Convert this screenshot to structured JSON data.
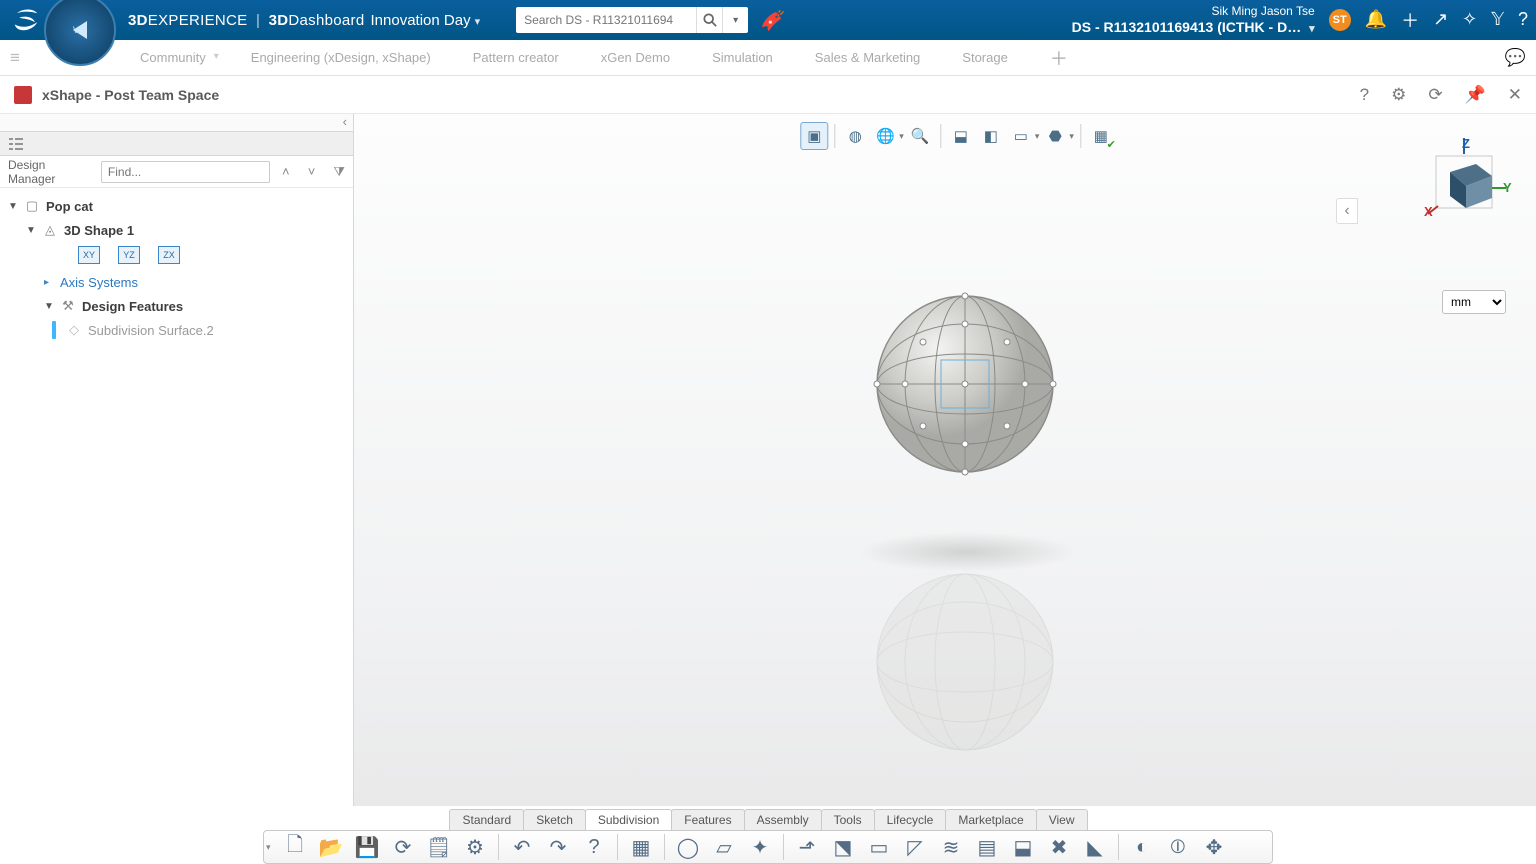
{
  "topbar": {
    "brand_pre": "3D",
    "brand_main": "EXPERIENCE",
    "brand_sep": "|",
    "brand_sub_bold": "3D",
    "brand_sub": "Dashboard",
    "context_dd": "Innovation Day",
    "search_placeholder": "Search DS - R11321011694",
    "user_name": "Sik Ming Jason Tse",
    "context_label": "DS - R1132101169413 (ICTHK - D…",
    "avatar_initials": "ST"
  },
  "tabstrip": {
    "items": [
      "Community",
      "Engineering (xDesign, xShape)",
      "Pattern creator",
      "xGen Demo",
      "Simulation",
      "Sales & Marketing",
      "Storage"
    ]
  },
  "apphdr": {
    "title": "xShape - Post Team Space"
  },
  "dm": {
    "label": "Design Manager",
    "find_placeholder": "Find..."
  },
  "tree": {
    "root": "Pop cat",
    "shape": "3D Shape 1",
    "planes": [
      "XY",
      "YZ",
      "ZX"
    ],
    "axis": "Axis Systems",
    "features": "Design Features",
    "subdiv": "Subdivision Surface.2"
  },
  "units": {
    "selected": "mm"
  },
  "triad": {
    "x": "X",
    "y": "Y",
    "z": "Z"
  },
  "bottom_tabs": [
    "Standard",
    "Sketch",
    "Subdivision",
    "Features",
    "Assembly",
    "Tools",
    "Lifecycle",
    "Marketplace",
    "View"
  ],
  "bottom_active": "Subdivision"
}
